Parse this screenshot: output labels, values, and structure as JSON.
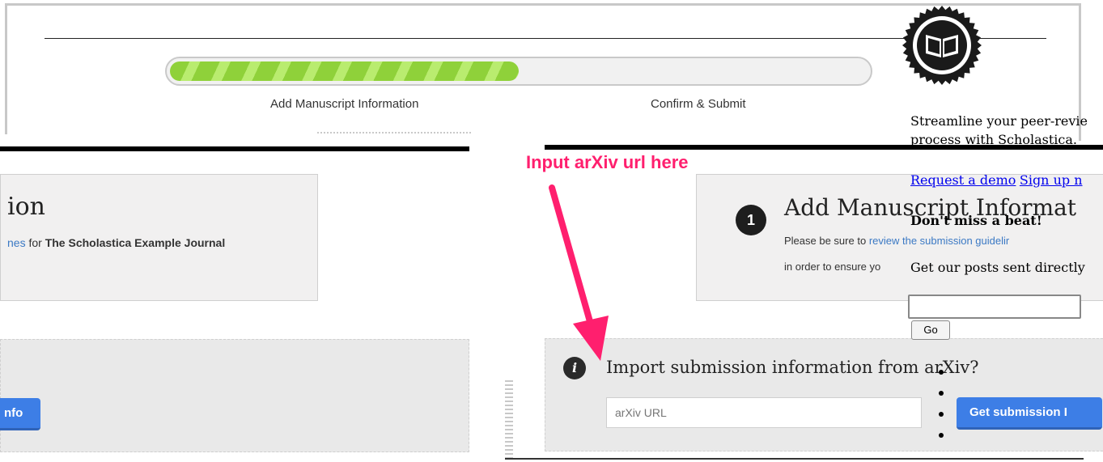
{
  "progress": {
    "percent": 50,
    "steps": [
      "Add Manuscript Information",
      "Confirm & Submit"
    ]
  },
  "left_panel": {
    "title_fragment": "ion",
    "guidelines_link_fragment": "nes",
    "for_text": "for",
    "journal_name": "The Scholastica Example Journal",
    "button_fragment": "nfo"
  },
  "annotation": {
    "text": "Input arXiv url here",
    "color": "#ff1f6e"
  },
  "manuscript_panel": {
    "step_number": "1",
    "title": "Add Manuscript Informat",
    "line1_prefix": "Please be sure to",
    "line1_link": "review the submission guidelir",
    "line2": "in order to ensure yo"
  },
  "import_panel": {
    "icon": "info-icon",
    "heading": "Import submission information from arXiv?",
    "input_placeholder": "arXiv URL",
    "button_label": "Get submission I"
  },
  "sidebar": {
    "logo_icon": "open-book-seal-icon",
    "promo_line1": "Streamline your peer-revie",
    "promo_line2": "process with Scholastica.",
    "request_demo": "Request a demo",
    "sign_up": "Sign up n",
    "heading": "Don't miss a beat!",
    "subscribe_text": "Get our posts sent directly",
    "email_value": "",
    "go_label": "Go"
  },
  "colors": {
    "progress_green": "#8fd13a",
    "button_blue": "#3d7ee6",
    "link_blue": "#3b79c4"
  }
}
